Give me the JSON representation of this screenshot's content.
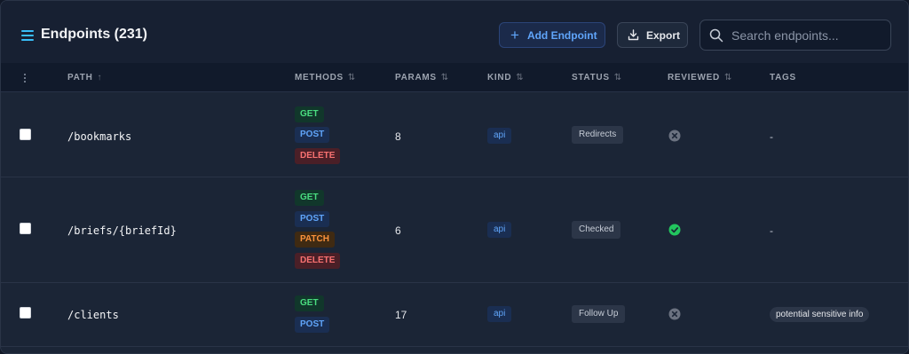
{
  "header": {
    "title": "Endpoints (231)",
    "add_button_label": "Add Endpoint",
    "export_button_label": "Export",
    "search_placeholder": "Search endpoints..."
  },
  "columns": {
    "path": "PATH",
    "methods": "METHODS",
    "params": "PARAMS",
    "kind": "KIND",
    "status": "STATUS",
    "reviewed": "REVIEWED",
    "tags": "TAGS"
  },
  "rows": [
    {
      "path": "/bookmarks",
      "methods": [
        "GET",
        "POST",
        "DELETE"
      ],
      "params": "8",
      "kind": "api",
      "status": "Redirects",
      "reviewed": "no",
      "tags": "-"
    },
    {
      "path": "/briefs/{briefId}",
      "methods": [
        "GET",
        "POST",
        "PATCH",
        "DELETE"
      ],
      "params": "6",
      "kind": "api",
      "status": "Checked",
      "reviewed": "yes",
      "tags": "-"
    },
    {
      "path": "/clients",
      "methods": [
        "GET",
        "POST"
      ],
      "params": "17",
      "kind": "api",
      "status": "Follow Up",
      "reviewed": "no",
      "tags": "potential sensitive info"
    }
  ],
  "colors": {
    "accent": "#60a5fa",
    "get": "#4ade80",
    "post": "#60a5fa",
    "patch": "#fb923c",
    "delete": "#f87171",
    "reviewed_yes": "#22c55e",
    "reviewed_no": "#6b7280"
  },
  "icons": {
    "menu": "hamburger-icon",
    "add": "plus-icon",
    "export": "download-icon",
    "search": "search-icon",
    "column_menu": "vertical-dots-icon",
    "sort": "sort-arrows-icon",
    "reviewed_yes": "check-circle-icon",
    "reviewed_no": "x-circle-icon"
  }
}
